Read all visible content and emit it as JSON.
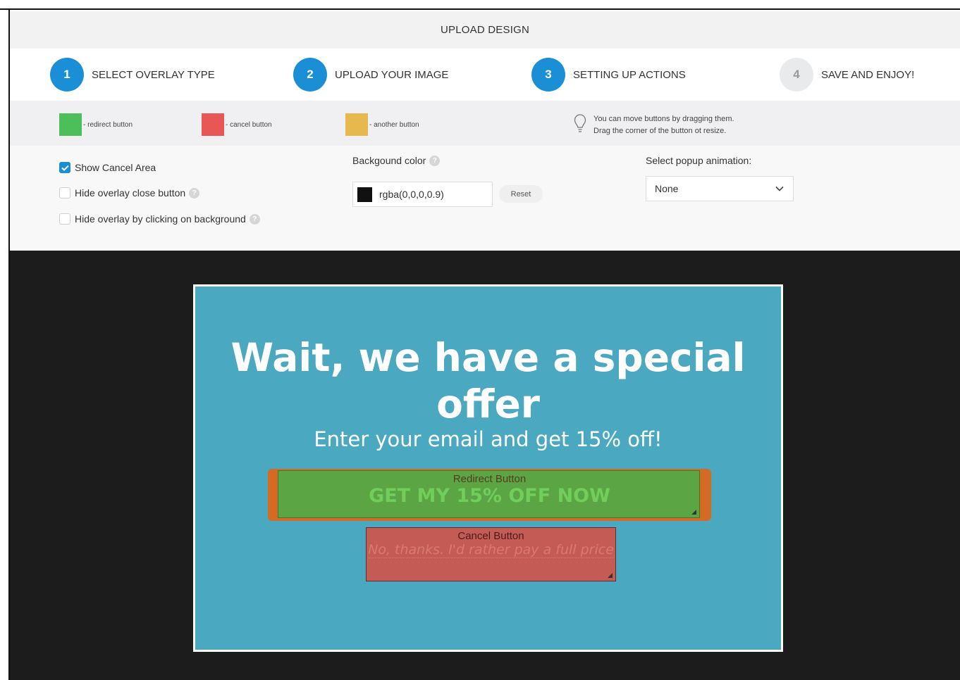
{
  "header": {
    "title": "UPLOAD DESIGN"
  },
  "steps": [
    {
      "number": "1",
      "label": "SELECT OVERLAY TYPE",
      "state": "active"
    },
    {
      "number": "2",
      "label": "UPLOAD YOUR IMAGE",
      "state": "active"
    },
    {
      "number": "3",
      "label": "SETTING UP ACTIONS",
      "state": "active"
    },
    {
      "number": "4",
      "label": "SAVE AND ENJOY!",
      "state": "inactive"
    }
  ],
  "legend": {
    "redirect": {
      "label": "- redirect button",
      "color": "#4cbf5a"
    },
    "cancel": {
      "label": "- cancel button",
      "color": "#e85656"
    },
    "another": {
      "label": "- another button",
      "color": "#e6b84e"
    },
    "hint_line1": "You can move buttons by dragging them.",
    "hint_line2": "Drag the corner of the button ot resize.",
    "hint_icon": "lightbulb-icon"
  },
  "settings": {
    "show_cancel_area": {
      "label": "Show Cancel Area",
      "checked": true
    },
    "hide_close_button": {
      "label": "Hide overlay close button",
      "checked": false
    },
    "hide_by_background": {
      "label": "Hide overlay by clicking on background",
      "checked": false
    },
    "bg_color_label": "Backgound color",
    "bg_color_value": "rgba(0,0,0,0.9)",
    "reset_label": "Reset",
    "animation_label": "Select popup animation:",
    "animation_value": "None"
  },
  "popup": {
    "title": "Wait, we have a special offer",
    "subtitle": "Enter your email and get 15% off!",
    "redirect_overlay_label": "Redirect Button",
    "redirect_cta": "GET MY 15% OFF NOW",
    "cancel_overlay_label": "Cancel Button",
    "cancel_text": "No, thanks. I'd rather pay a full price"
  },
  "colors": {
    "accent": "#1a8fd6",
    "popup_bg": "#4aa8c0",
    "canvas_bg": "#1c1c1c"
  }
}
